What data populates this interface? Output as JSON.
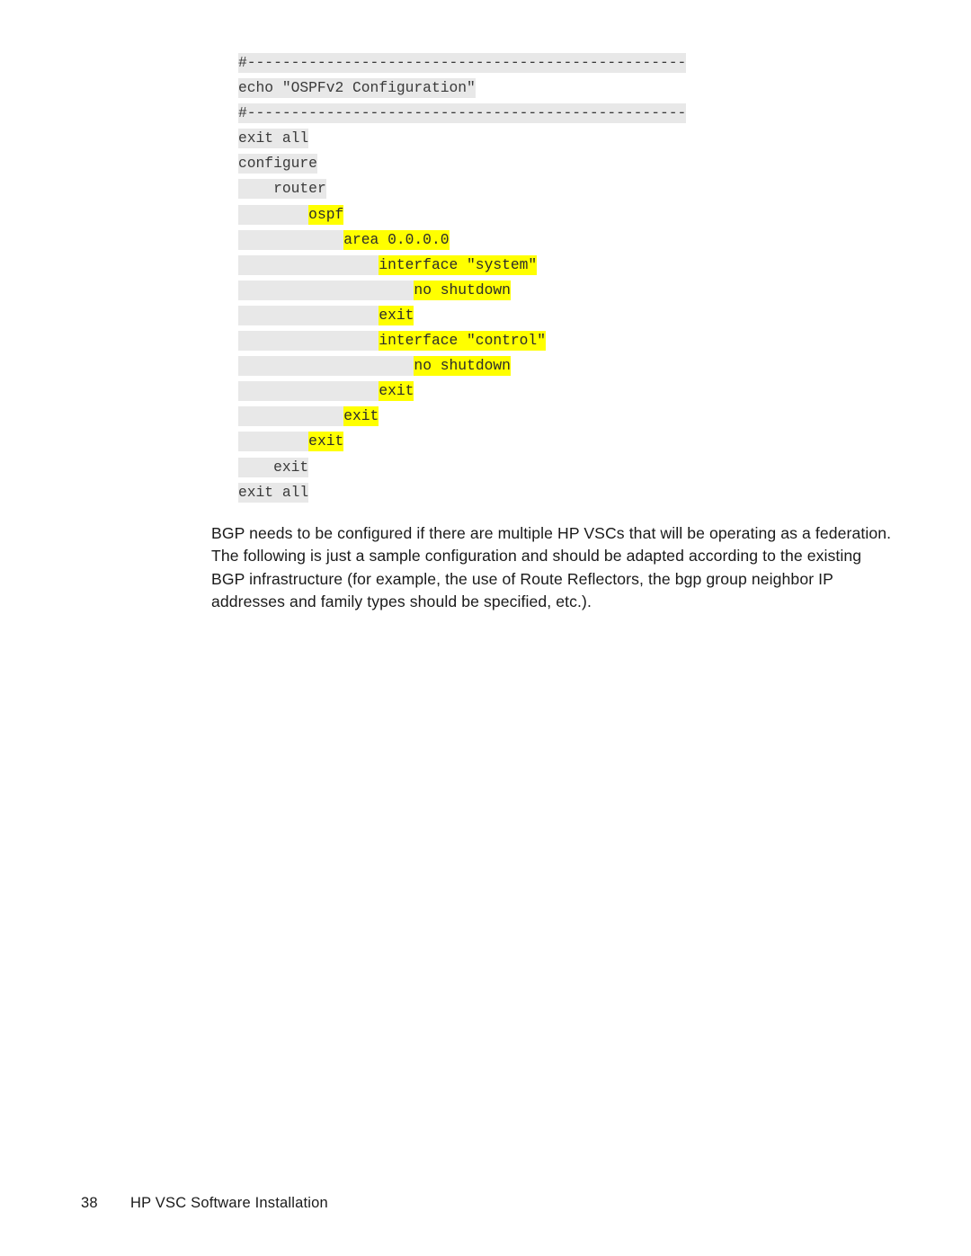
{
  "document": {
    "code_block": {
      "language": "cli-config",
      "lines": [
        {
          "indent": 0,
          "text": "#--------------------------------------------------",
          "highlight": false
        },
        {
          "indent": 0,
          "text": "echo \"OSPFv2 Configuration\"",
          "highlight": false
        },
        {
          "indent": 0,
          "text": "#--------------------------------------------------",
          "highlight": false
        },
        {
          "indent": 0,
          "text": "exit all",
          "highlight": false
        },
        {
          "indent": 0,
          "text": "configure",
          "highlight": false
        },
        {
          "indent": 4,
          "text": "router",
          "highlight": false
        },
        {
          "indent": 8,
          "text": "ospf",
          "highlight": true
        },
        {
          "indent": 12,
          "text": "area 0.0.0.0",
          "highlight": true
        },
        {
          "indent": 16,
          "text": "interface \"system\"",
          "highlight": true
        },
        {
          "indent": 20,
          "text": "no shutdown",
          "highlight": true
        },
        {
          "indent": 16,
          "text": "exit",
          "highlight": true
        },
        {
          "indent": 16,
          "text": "interface \"control\"",
          "highlight": true
        },
        {
          "indent": 20,
          "text": "no shutdown",
          "highlight": true
        },
        {
          "indent": 16,
          "text": "exit",
          "highlight": true
        },
        {
          "indent": 12,
          "text": "exit",
          "highlight": true
        },
        {
          "indent": 8,
          "text": "exit",
          "highlight": true
        },
        {
          "indent": 4,
          "text": "exit",
          "highlight": false
        },
        {
          "indent": 0,
          "text": "exit all",
          "highlight": false
        }
      ]
    },
    "paragraph": "BGP needs to be configured if there are multiple HP VSCs that will be operating as a federation. The following is just a sample configuration and should be adapted according to the existing BGP infrastructure (for example, the use of Route Reflectors, the bgp group neighbor IP addresses and family types should be specified, etc.).",
    "footer": {
      "page_number": "38",
      "title": "HP VSC Software Installation"
    },
    "colors": {
      "code_background": "#e8e8e8",
      "highlight": "#ffff00",
      "code_text": "#3a3a3a",
      "body_text": "#1a1a1a",
      "page_background": "#ffffff"
    }
  }
}
